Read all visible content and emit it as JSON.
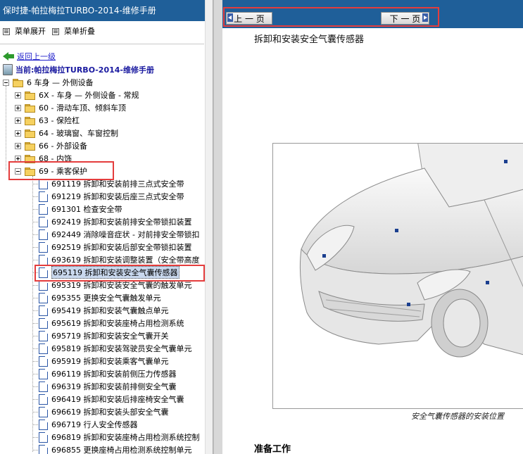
{
  "left_panel": {
    "title": "保时捷-帕拉梅拉TURBO-2014-维修手册",
    "expand_all": "菜单展开",
    "collapse_all": "菜单折叠",
    "back_link": "返回上一级",
    "current": "当前:帕拉梅拉TURBO-2014-维修手册",
    "tree": {
      "root": "6 车身 — 外侧设备",
      "folders": [
        "6X - 车身 — 外侧设备 - 常规",
        "60 - 滑动车顶、倾斜车顶",
        "63 - 保险杠",
        "64 - 玻璃窗、车窗控制",
        "66 - 外部设备",
        "68 - 内饰"
      ],
      "open_folder": "69 - 乘客保护",
      "documents": [
        "691119 拆卸和安装前排三点式安全带",
        "691219 拆卸和安装后座三点式安全带",
        "691301 检查安全带",
        "692419 拆卸和安装前排安全带锁扣装置",
        "692449 消除噪音症状 - 对前排安全带锁扣",
        "692519 拆卸和安装后部安全带锁扣装置",
        "693619 拆卸和安装调整装置（安全带高度",
        "695119 拆卸和安装安全气囊传感器",
        "695319 拆卸和安装安全气囊的触发单元",
        "695355 更换安全气囊触发单元",
        "695419 拆卸和安装气囊触点单元",
        "695619 拆卸和安装座椅占用检测系统",
        "695719 拆卸和安装安全气囊开关",
        "695819 拆卸和安装驾驶员安全气囊单元",
        "695919 拆卸和安装乘客气囊单元",
        "696119 拆卸和安装前侧压力传感器",
        "696319 拆卸和安装前排侧安全气囊",
        "696419 拆卸和安装后排座椅安全气囊",
        "696619 拆卸和安装头部安全气囊",
        "696719 行人安全传感器",
        "696819 拆卸和安装座椅占用检测系统控制",
        "696855 更换座椅占用检测系统控制单元"
      ],
      "selected_index": 7
    }
  },
  "right_panel": {
    "prev_label": "上 一 页",
    "next_label": "下 一 页",
    "doc_title": "拆卸和安装安全气囊传感器",
    "caption": "安全气囊传感器的安装位置",
    "section_heading": "准备工作"
  },
  "colors": {
    "header_blue": "#1f5f99",
    "highlight_red": "#e43d3d",
    "sensor_blue": "#1b3f8f"
  }
}
